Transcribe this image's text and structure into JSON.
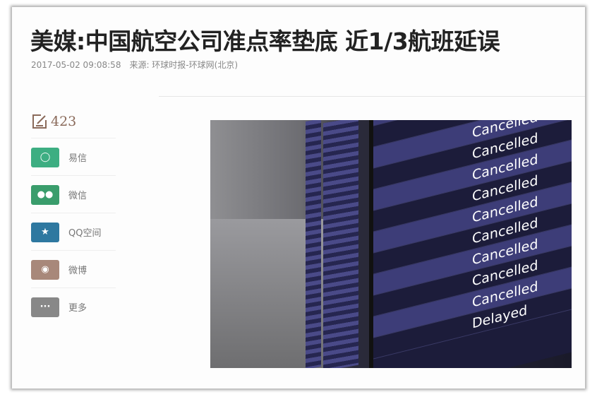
{
  "article": {
    "title": "美媒:中国航空公司准点率垫底 近1/3航班延误",
    "date": "2017-05-02 09:08:58",
    "source": "来源: 环球时报-环球网(北京)"
  },
  "sidebar": {
    "comment_count": "423",
    "share": [
      {
        "label": "易信",
        "icon": "yixin-icon",
        "color": "#3dae82"
      },
      {
        "label": "微信",
        "icon": "wechat-icon",
        "color": "#3a9d6c"
      },
      {
        "label": "QQ空间",
        "icon": "qzone-icon",
        "color": "#2e78a0"
      },
      {
        "label": "微博",
        "icon": "weibo-icon",
        "color": "#a8887a"
      },
      {
        "label": "更多",
        "icon": "more-icon",
        "color": "#888888"
      }
    ]
  },
  "photo": {
    "board_status": [
      "Cancelled",
      "Cancelled",
      "Cancelled",
      "Cancelled",
      "Cancelled",
      "Cancelled",
      "Cancelled",
      "Cancelled",
      "Cancelled",
      "Cancelled",
      "Cancelled",
      "Delayed"
    ]
  }
}
